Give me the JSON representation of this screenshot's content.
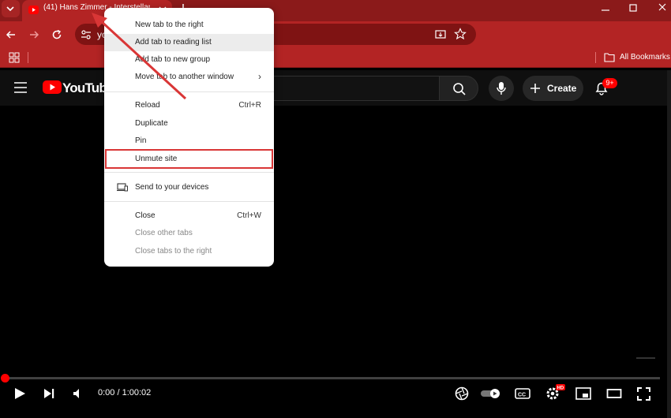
{
  "browser": {
    "tab_title": "(41) Hans Zimmer - Interstellar",
    "omnibox_text": "yo",
    "bookmarks_label": "All Bookmarks"
  },
  "youtube": {
    "logo_text": "YouTube",
    "create_label": "Create",
    "notification_badge": "9+",
    "time_display": "0:00 / 1:00:02",
    "progress": 0
  },
  "context_menu": {
    "items": [
      {
        "label": "New tab to the right",
        "shortcut": ""
      },
      {
        "label": "Add tab to reading list",
        "shortcut": ""
      },
      {
        "label": "Add tab to new group",
        "shortcut": ""
      },
      {
        "label": "Move tab to another window",
        "shortcut": "›"
      },
      {
        "label": "Reload",
        "shortcut": "Ctrl+R"
      },
      {
        "label": "Duplicate",
        "shortcut": ""
      },
      {
        "label": "Pin",
        "shortcut": ""
      },
      {
        "label": "Unmute site",
        "shortcut": ""
      },
      {
        "label": "Send to your devices",
        "shortcut": ""
      },
      {
        "label": "Close",
        "shortcut": "Ctrl+W"
      },
      {
        "label": "Close other tabs",
        "shortcut": ""
      },
      {
        "label": "Close tabs to the right",
        "shortcut": ""
      }
    ]
  },
  "colors": {
    "browser_frame": "#8b1a1a",
    "browser_toolbar": "#b32424",
    "highlight_box": "#d93636",
    "youtube_red": "#ff0000"
  }
}
